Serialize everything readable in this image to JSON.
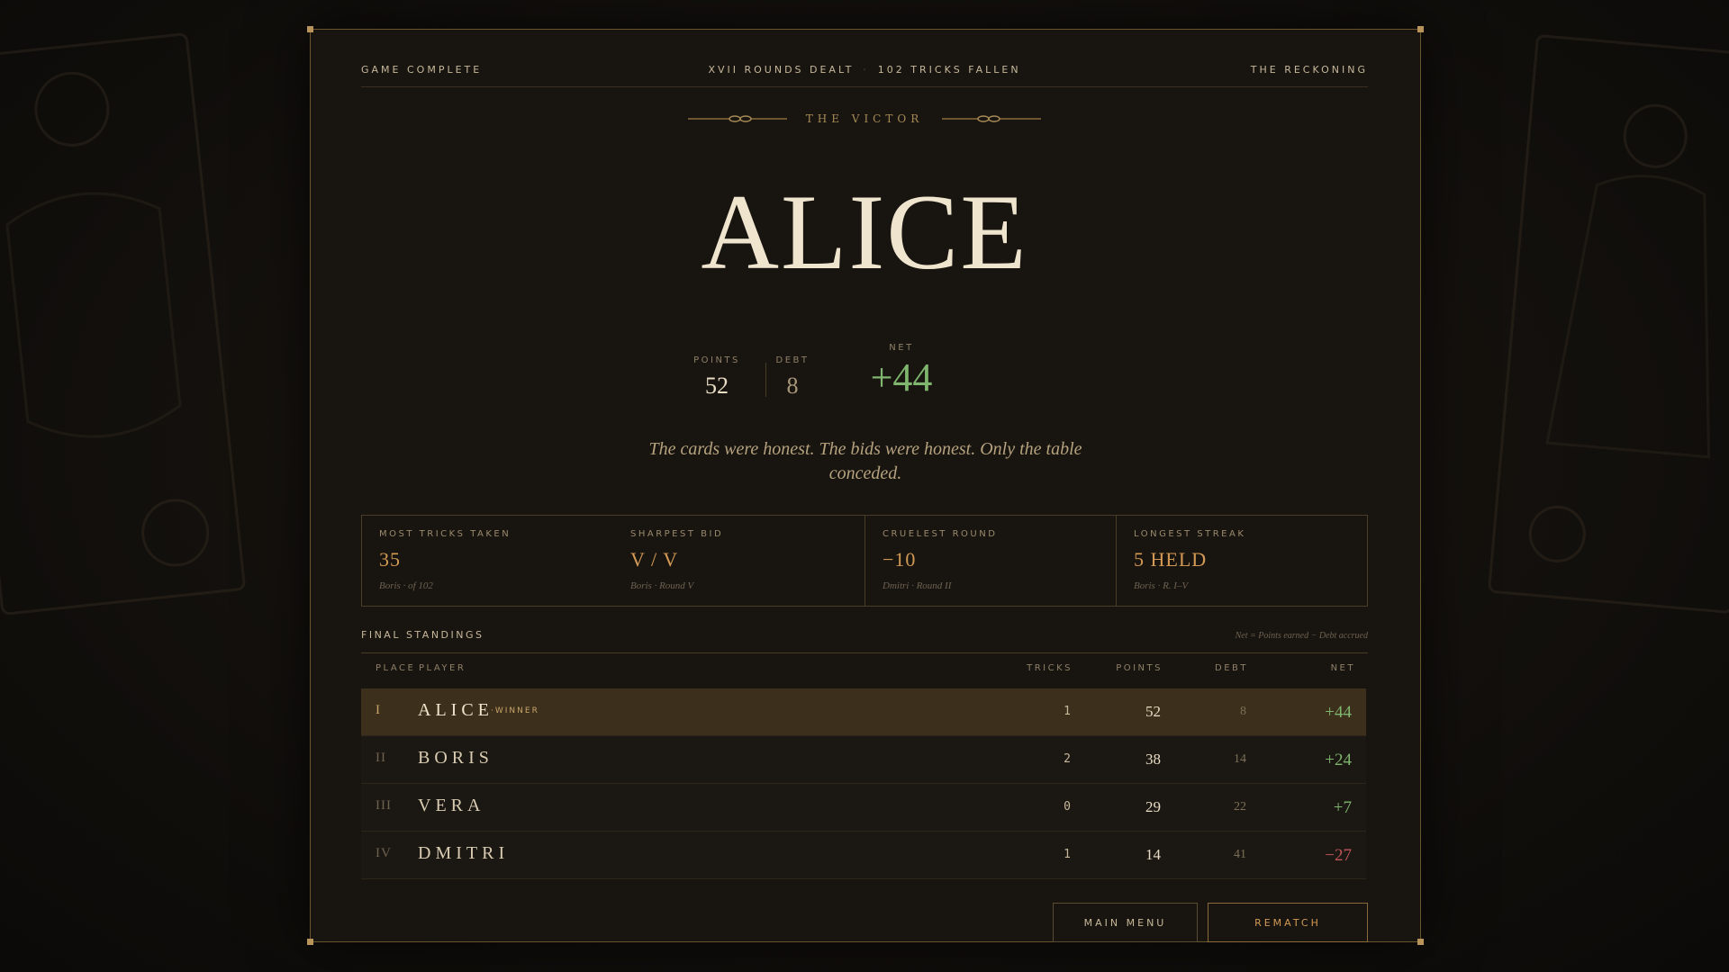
{
  "header": {
    "status": "GAME COMPLETE",
    "rounds": "XVII ROUNDS DEALT",
    "tricks": "102 TRICKS FALLEN",
    "title": "THE RECKONING"
  },
  "victor": {
    "label": "THE VICTOR",
    "name": "ALICE",
    "points_label": "POINTS",
    "points": "52",
    "debt_label": "DEBT",
    "debt": "8",
    "net_label": "NET",
    "net": "+44"
  },
  "quote": "The cards were honest. The bids were honest. Only the table conceded.",
  "awards": [
    {
      "label": "MOST TRICKS TAKEN",
      "value": "35",
      "sub": "Boris · of 102"
    },
    {
      "label": "SHARPEST BID",
      "value": "V / V",
      "sub": "Boris · Round V"
    },
    {
      "label": "CRUELEST ROUND",
      "value": "−10",
      "sub": "Dmitri · Round II"
    },
    {
      "label": "LONGEST STREAK",
      "value": "5 HELD",
      "sub": "Boris · R. I–V"
    }
  ],
  "standings": {
    "title": "FINAL STANDINGS",
    "note": "Net = Points earned − Debt accrued",
    "columns": {
      "place": "PLACE",
      "player": "PLAYER",
      "tricks": "TRICKS",
      "points": "POINTS",
      "debt": "DEBT",
      "net": "NET"
    },
    "rows": [
      {
        "place": "I",
        "name": "ALICE",
        "tag": "·WINNER",
        "tricks": "1",
        "points": "52",
        "debt": "8",
        "net": "+44"
      },
      {
        "place": "II",
        "name": "BORIS",
        "tag": "",
        "tricks": "2",
        "points": "38",
        "debt": "14",
        "net": "+24"
      },
      {
        "place": "III",
        "name": "VERA",
        "tag": "",
        "tricks": "0",
        "points": "29",
        "debt": "22",
        "net": "+7"
      },
      {
        "place": "IV",
        "name": "DMITRI",
        "tag": "",
        "tricks": "1",
        "points": "14",
        "debt": "41",
        "net": "−27"
      }
    ]
  },
  "buttons": {
    "menu": "MAIN MENU",
    "rematch": "REMATCH"
  },
  "colors": {
    "accent": "#d39a55",
    "positive": "#7fb56e",
    "negative": "#c0545a",
    "border": "#6a5530"
  }
}
